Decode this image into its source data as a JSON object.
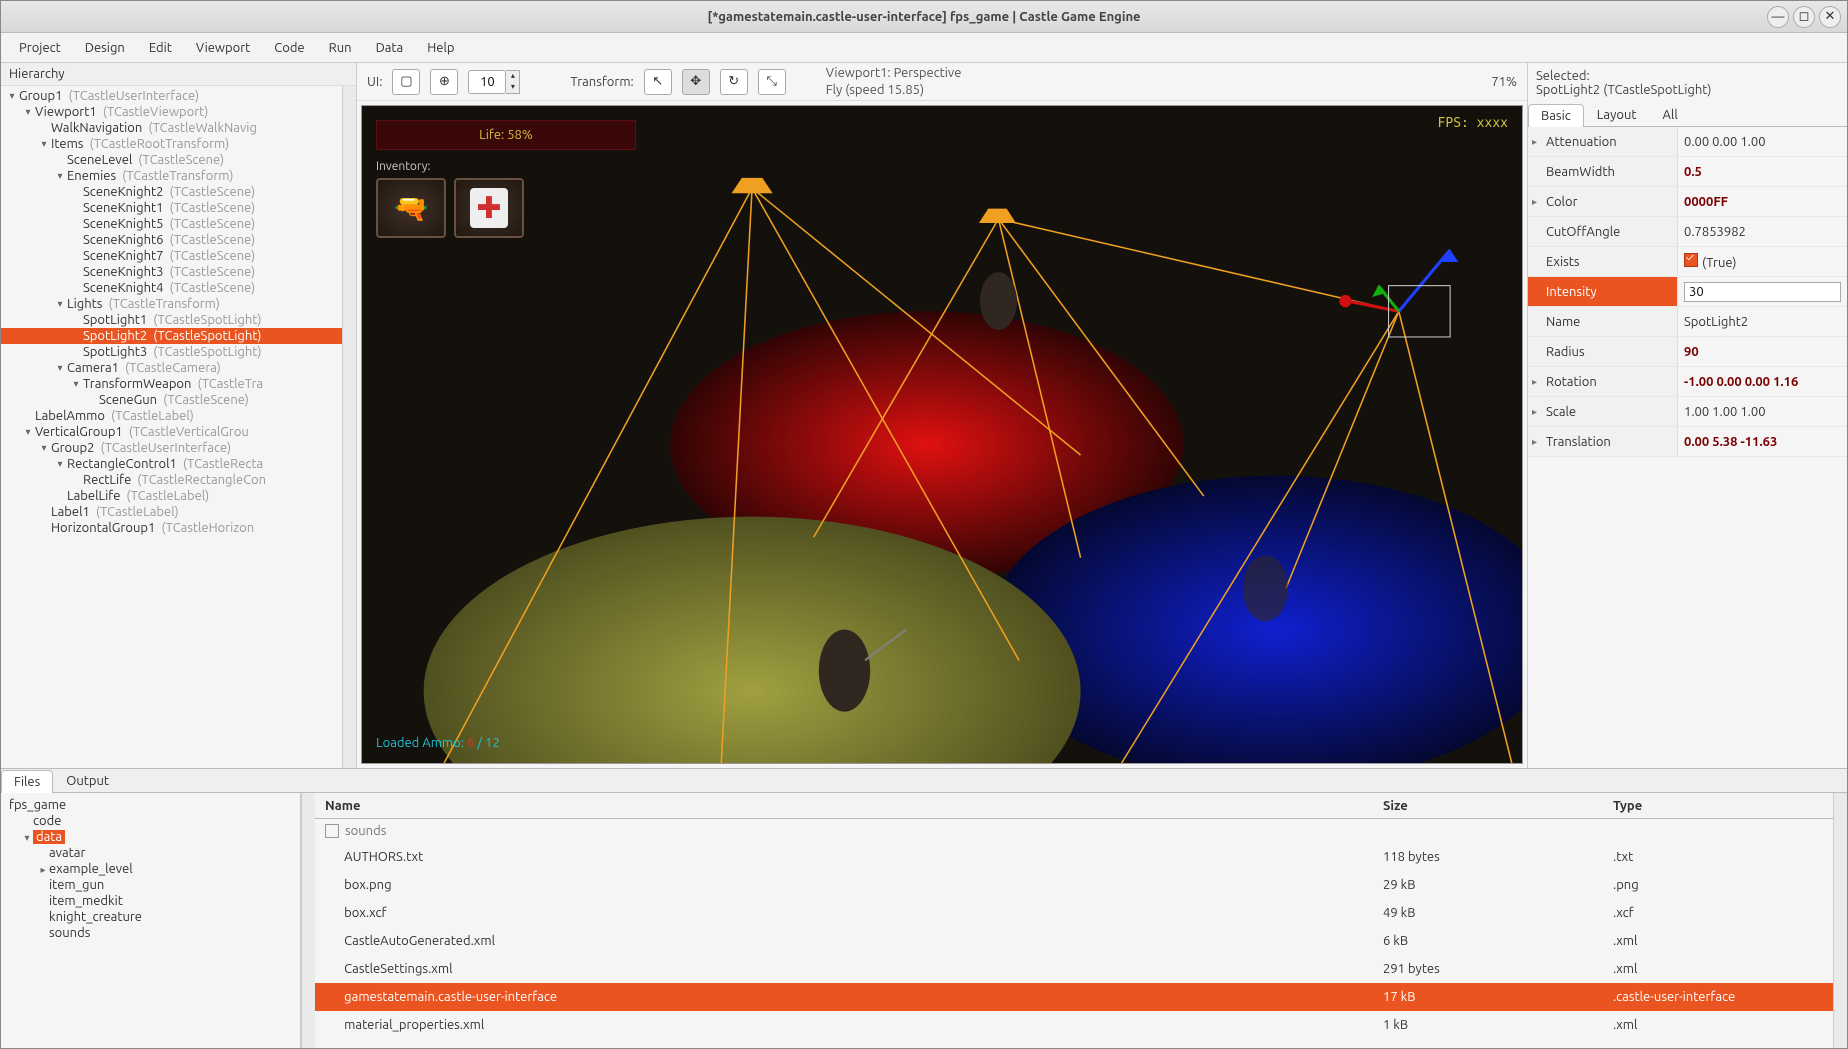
{
  "title": "[*gamestatemain.castle-user-interface] fps_game | Castle Game Engine",
  "menu": [
    "Project",
    "Design",
    "Edit",
    "Viewport",
    "Code",
    "Run",
    "Data",
    "Help"
  ],
  "hierarchy_label": "Hierarchy",
  "tree": [
    {
      "d": 0,
      "tw": "▾",
      "name": "Group1",
      "cls": "(TCastleUserInterface)"
    },
    {
      "d": 1,
      "tw": "▾",
      "name": "Viewport1",
      "cls": "(TCastleViewport)"
    },
    {
      "d": 2,
      "tw": "",
      "name": "WalkNavigation",
      "cls": "(TCastleWalkNavig"
    },
    {
      "d": 2,
      "tw": "▾",
      "name": "Items",
      "cls": "(TCastleRootTransform)"
    },
    {
      "d": 3,
      "tw": "",
      "name": "SceneLevel",
      "cls": "(TCastleScene)"
    },
    {
      "d": 3,
      "tw": "▾",
      "name": "Enemies",
      "cls": "(TCastleTransform)"
    },
    {
      "d": 4,
      "tw": "",
      "name": "SceneKnight2",
      "cls": "(TCastleScene)"
    },
    {
      "d": 4,
      "tw": "",
      "name": "SceneKnight1",
      "cls": "(TCastleScene)"
    },
    {
      "d": 4,
      "tw": "",
      "name": "SceneKnight5",
      "cls": "(TCastleScene)"
    },
    {
      "d": 4,
      "tw": "",
      "name": "SceneKnight6",
      "cls": "(TCastleScene)"
    },
    {
      "d": 4,
      "tw": "",
      "name": "SceneKnight7",
      "cls": "(TCastleScene)"
    },
    {
      "d": 4,
      "tw": "",
      "name": "SceneKnight3",
      "cls": "(TCastleScene)"
    },
    {
      "d": 4,
      "tw": "",
      "name": "SceneKnight4",
      "cls": "(TCastleScene)"
    },
    {
      "d": 3,
      "tw": "▾",
      "name": "Lights",
      "cls": "(TCastleTransform)"
    },
    {
      "d": 4,
      "tw": "",
      "name": "SpotLight1",
      "cls": "(TCastleSpotLight)"
    },
    {
      "d": 4,
      "tw": "",
      "name": "SpotLight2",
      "cls": "(TCastleSpotLight)",
      "sel": true
    },
    {
      "d": 4,
      "tw": "",
      "name": "SpotLight3",
      "cls": "(TCastleSpotLight)"
    },
    {
      "d": 3,
      "tw": "▾",
      "name": "Camera1",
      "cls": "(TCastleCamera)"
    },
    {
      "d": 4,
      "tw": "▾",
      "name": "TransformWeapon",
      "cls": "(TCastleTra"
    },
    {
      "d": 5,
      "tw": "",
      "name": "SceneGun",
      "cls": "(TCastleScene)"
    },
    {
      "d": 1,
      "tw": "",
      "name": "LabelAmmo",
      "cls": "(TCastleLabel)"
    },
    {
      "d": 1,
      "tw": "▾",
      "name": "VerticalGroup1",
      "cls": "(TCastleVerticalGrou"
    },
    {
      "d": 2,
      "tw": "▾",
      "name": "Group2",
      "cls": "(TCastleUserInterface)"
    },
    {
      "d": 3,
      "tw": "▾",
      "name": "RectangleControl1",
      "cls": "(TCastleRecta"
    },
    {
      "d": 4,
      "tw": "",
      "name": "RectLife",
      "cls": "(TCastleRectangleCon"
    },
    {
      "d": 3,
      "tw": "",
      "name": "LabelLife",
      "cls": "(TCastleLabel)"
    },
    {
      "d": 2,
      "tw": "",
      "name": "Label1",
      "cls": "(TCastleLabel)"
    },
    {
      "d": 2,
      "tw": "",
      "name": "HorizontalGroup1",
      "cls": "(TCastleHorizon"
    }
  ],
  "toolbar": {
    "ui_label": "UI:",
    "snap_value": "10",
    "transform_label": "Transform:",
    "viewport_info_l1": "Viewport1: Perspective",
    "viewport_info_l2": "Fly (speed 15.85)",
    "zoom": "71%"
  },
  "viewport": {
    "life": "Life: 58%",
    "inventory_label": "Inventory:",
    "fps": "FPS: xxxx",
    "loaded_ammo_label": "Loaded Ammo: ",
    "loaded_ammo_cur": "6",
    "loaded_ammo_sep": " / 12"
  },
  "selected": {
    "header": "Selected:",
    "object": "SpotLight2 (TCastleSpotLight)"
  },
  "prop_tabs": [
    "Basic",
    "Layout",
    "All"
  ],
  "props": [
    {
      "k": "Attenuation",
      "v": "0.00 0.00 1.00",
      "tw": "▸"
    },
    {
      "k": "BeamWidth",
      "v": "0.5",
      "bold": true
    },
    {
      "k": "Color",
      "v": "0000FF",
      "bold": true,
      "tw": "▸"
    },
    {
      "k": "CutOffAngle",
      "v": "0.7853982"
    },
    {
      "k": "Exists",
      "v": "(True)",
      "check": true
    },
    {
      "k": "Intensity",
      "v": "30",
      "bold": true,
      "sel": true,
      "edit": true
    },
    {
      "k": "Name",
      "v": "SpotLight2"
    },
    {
      "k": "Radius",
      "v": "90",
      "bold": true
    },
    {
      "k": "Rotation",
      "v": "-1.00 0.00 0.00 1.16",
      "bold": true,
      "tw": "▸"
    },
    {
      "k": "Scale",
      "v": "1.00 1.00 1.00",
      "tw": "▸"
    },
    {
      "k": "Translation",
      "v": "0.00 5.38 -11.63",
      "bold": true,
      "tw": "▸"
    }
  ],
  "bottom_tabs": [
    "Files",
    "Output"
  ],
  "file_tree_root": "fps_game",
  "file_tree": [
    {
      "d": 1,
      "tw": "",
      "name": "code"
    },
    {
      "d": 1,
      "tw": "▾",
      "name": "data",
      "sel": true
    },
    {
      "d": 2,
      "tw": "",
      "name": "avatar"
    },
    {
      "d": 2,
      "tw": "▸",
      "name": "example_level"
    },
    {
      "d": 2,
      "tw": "",
      "name": "item_gun"
    },
    {
      "d": 2,
      "tw": "",
      "name": "item_medkit"
    },
    {
      "d": 2,
      "tw": "",
      "name": "knight_creature"
    },
    {
      "d": 2,
      "tw": "",
      "name": "sounds"
    }
  ],
  "file_cols": {
    "name": "Name",
    "size": "Size",
    "type": "Type"
  },
  "folder_cut": "sounds",
  "files": [
    {
      "name": "AUTHORS.txt",
      "size": "118 bytes",
      "type": ".txt"
    },
    {
      "name": "box.png",
      "size": "29 kB",
      "type": ".png"
    },
    {
      "name": "box.xcf",
      "size": "49 kB",
      "type": ".xcf"
    },
    {
      "name": "CastleAutoGenerated.xml",
      "size": "6 kB",
      "type": ".xml"
    },
    {
      "name": "CastleSettings.xml",
      "size": "291 bytes",
      "type": ".xml"
    },
    {
      "name": "gamestatemain.castle-user-interface",
      "size": "17 kB",
      "type": ".castle-user-interface",
      "sel": true
    },
    {
      "name": "material_properties.xml",
      "size": "1 kB",
      "type": ".xml"
    }
  ],
  "icons": {
    "minimize": "—",
    "maximize": "◻",
    "close": "✕",
    "select": "▢",
    "anchor": "⊕",
    "pointer": "↖",
    "move": "✥",
    "rotate": "↻",
    "scale": "⤡",
    "medkit": "✚",
    "gun": "🔫"
  }
}
